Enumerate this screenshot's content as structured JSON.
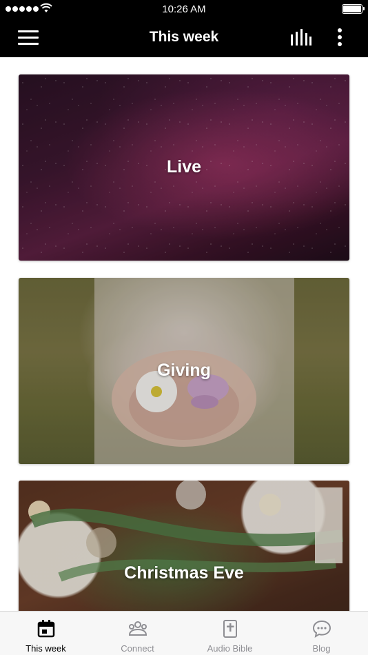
{
  "status_bar": {
    "time": "10:26 AM",
    "battery_icon": "battery-full-icon",
    "signal_icon": "signal-dots-icon",
    "wifi_icon": "wifi-icon"
  },
  "nav": {
    "title": "This week",
    "menu_icon": "hamburger-menu-icon",
    "audio_icon": "audio-bars-icon",
    "more_icon": "more-vertical-icon"
  },
  "cards": [
    {
      "title": "Live"
    },
    {
      "title": "Giving"
    },
    {
      "title": "Christmas Eve"
    }
  ],
  "tabs": [
    {
      "label": "This week",
      "icon": "calendar-icon",
      "active": true
    },
    {
      "label": "Connect",
      "icon": "people-icon",
      "active": false
    },
    {
      "label": "Audio Bible",
      "icon": "bible-icon",
      "active": false
    },
    {
      "label": "Blog",
      "icon": "chat-bubble-icon",
      "active": false
    }
  ],
  "colors": {
    "header_bg": "#000000",
    "tab_active": "#000000",
    "tab_inactive": "#8e8e93"
  }
}
